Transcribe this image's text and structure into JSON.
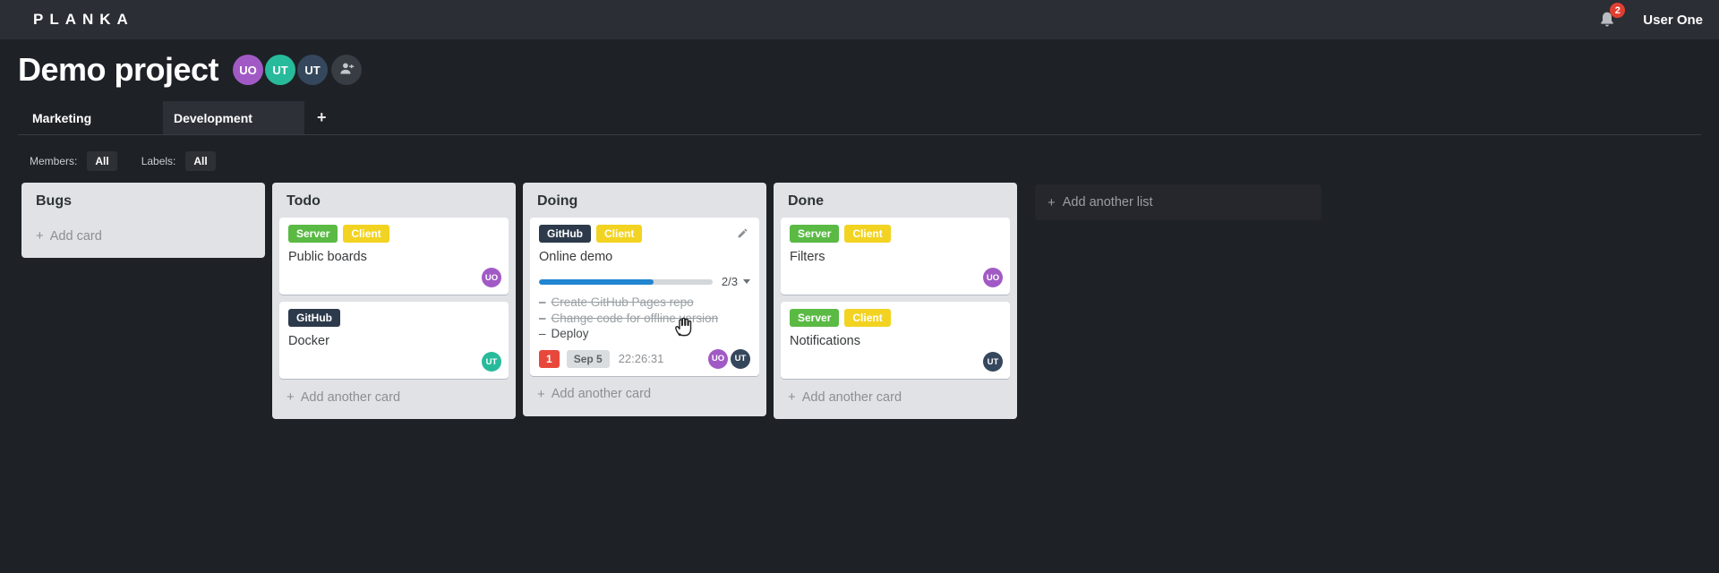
{
  "app": {
    "logo": "PLANKA",
    "notifications_count": "2",
    "user_name": "User One"
  },
  "project": {
    "title": "Demo project",
    "avatars": [
      {
        "initials": "UO",
        "color": "#a15ac5"
      },
      {
        "initials": "UT",
        "color": "#27bb9b"
      },
      {
        "initials": "UT",
        "color": "#35475c"
      }
    ],
    "tabs": [
      {
        "label": "Marketing"
      },
      {
        "label": "Development"
      }
    ],
    "add_tab_label": "+"
  },
  "filters": {
    "members_label": "Members:",
    "members_value": "All",
    "labels_label": "Labels:",
    "labels_value": "All"
  },
  "board": {
    "add_icon": "+",
    "task_marker": "–",
    "add_list_label": "Add another list",
    "lists": [
      {
        "title": "Bugs",
        "add_card_label": "Add card",
        "cards": []
      },
      {
        "title": "Todo",
        "add_card_label": "Add another card",
        "cards": [
          {
            "name": "Public boards",
            "labels": [
              {
                "text": "Server",
                "color": "#5aba44"
              },
              {
                "text": "Client",
                "color": "#f2d321"
              }
            ],
            "avatars": [
              {
                "initials": "UO",
                "color": "#a15ac5"
              }
            ]
          },
          {
            "name": "Docker",
            "labels": [
              {
                "text": "GitHub",
                "color": "#2d3a4b"
              }
            ],
            "avatars": [
              {
                "initials": "UT",
                "color": "#27bb9b"
              }
            ]
          }
        ]
      },
      {
        "title": "Doing",
        "add_card_label": "Add another card",
        "cards": [
          {
            "name": "Online demo",
            "labels": [
              {
                "text": "GitHub",
                "color": "#2d3a4b"
              },
              {
                "text": "Client",
                "color": "#f2d321"
              }
            ],
            "progress": {
              "label": "2/3",
              "percent": 66,
              "bar_color": "#2185d0"
            },
            "tasks": [
              {
                "text": "Create GitHub Pages repo",
                "done": true
              },
              {
                "text": "Change code for offline version",
                "done": true
              },
              {
                "text": "Deploy",
                "done": false
              }
            ],
            "badges": {
              "count": "1",
              "count_color": "#e8483b",
              "due_date": "Sep 5",
              "timer": "22:26:31"
            },
            "avatars": [
              {
                "initials": "UO",
                "color": "#a15ac5"
              },
              {
                "initials": "UT",
                "color": "#35475c"
              }
            ]
          }
        ]
      },
      {
        "title": "Done",
        "add_card_label": "Add another card",
        "cards": [
          {
            "name": "Filters",
            "labels": [
              {
                "text": "Server",
                "color": "#5aba44"
              },
              {
                "text": "Client",
                "color": "#f2d321"
              }
            ],
            "avatars": [
              {
                "initials": "UO",
                "color": "#a15ac5"
              }
            ]
          },
          {
            "name": "Notifications",
            "labels": [
              {
                "text": "Server",
                "color": "#5aba44"
              },
              {
                "text": "Client",
                "color": "#f2d321"
              }
            ],
            "avatars": [
              {
                "initials": "UT",
                "color": "#35475c"
              }
            ]
          }
        ]
      }
    ]
  }
}
